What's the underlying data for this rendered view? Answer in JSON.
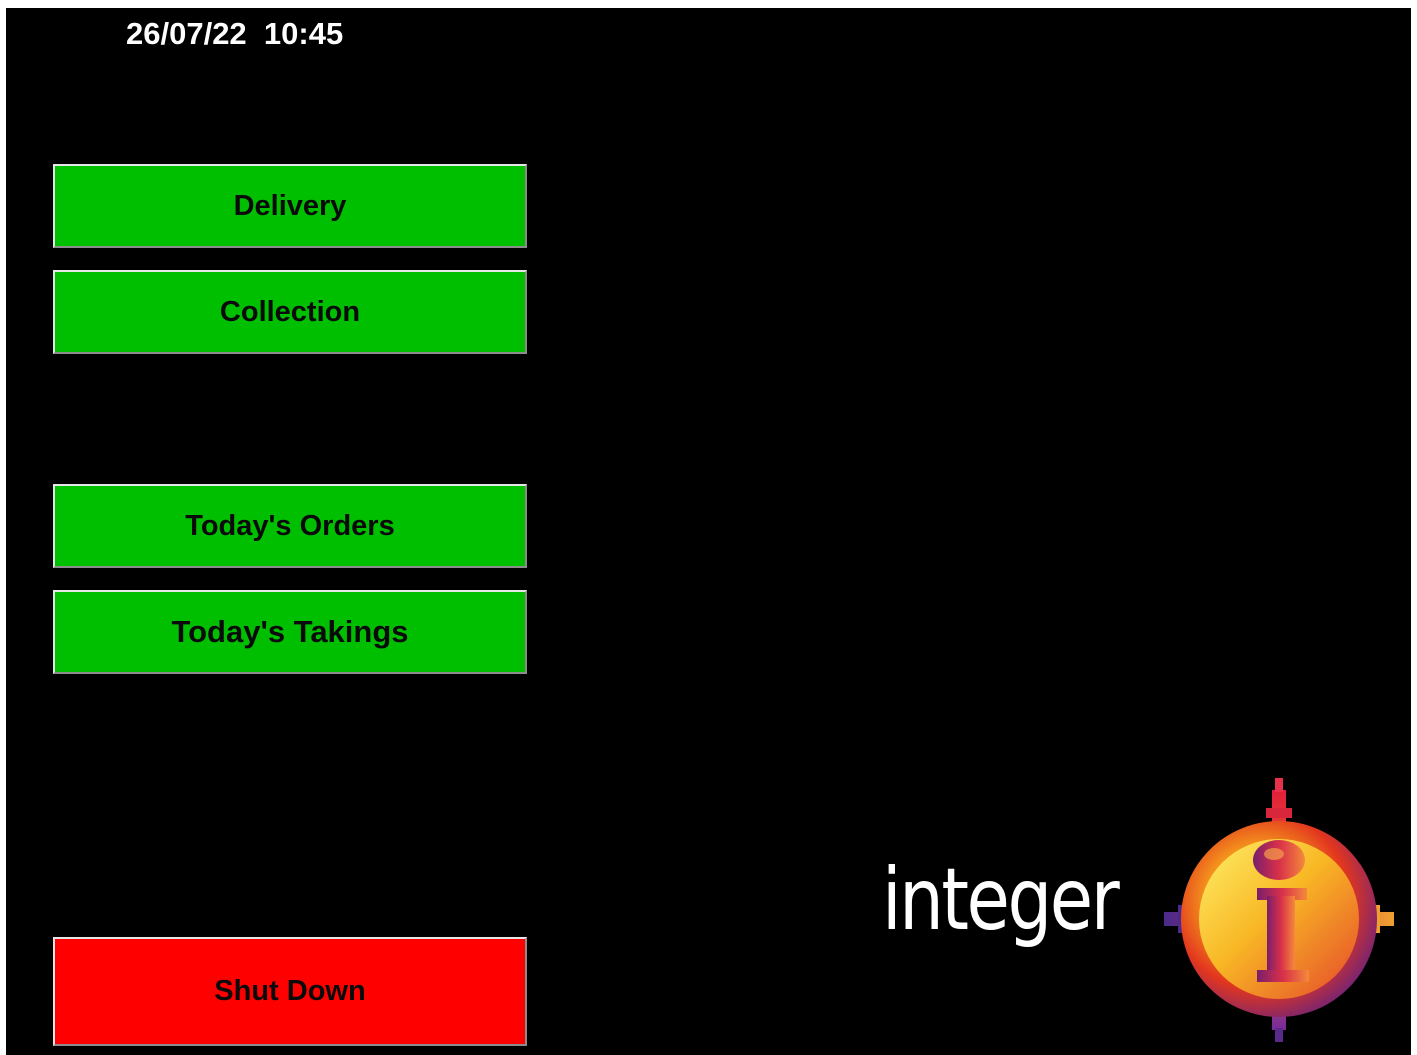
{
  "status_bar": {
    "datetime": "26/07/22  10:45"
  },
  "menu": {
    "buttons": [
      {
        "label": "Delivery",
        "color": "#00bf00"
      },
      {
        "label": "Collection",
        "color": "#00bf00"
      },
      {
        "label": "Today's Orders",
        "color": "#00bf00"
      },
      {
        "label": "Today's Takings",
        "color": "#00bf00"
      }
    ],
    "shutdown": {
      "label": "Shut Down",
      "color": "#ff0000"
    }
  },
  "logo": {
    "wordmark": "integer",
    "icon": "integer-i-emblem-icon"
  },
  "theme": {
    "background": "#000000",
    "text": "#ffffff"
  }
}
